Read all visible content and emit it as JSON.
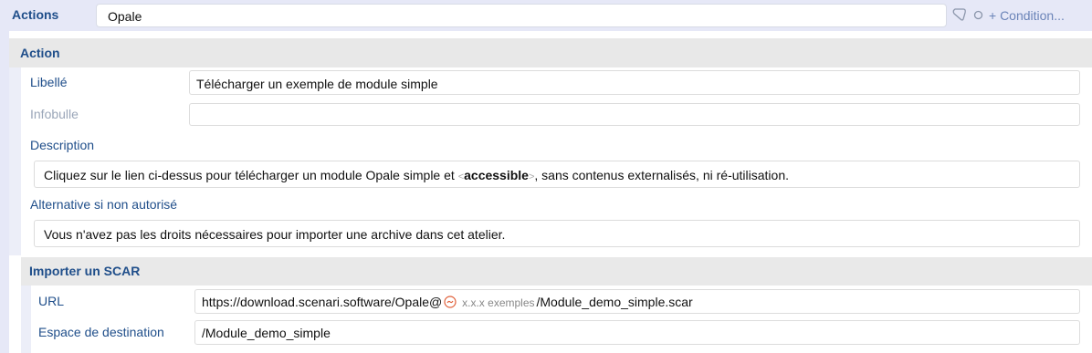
{
  "header": {
    "title": "Actions",
    "value": "Opale",
    "condition_link": "+ Condition...",
    "icons": [
      "condition-shape-icon",
      "circle-icon"
    ]
  },
  "action": {
    "section_title": "Action",
    "libelle_label": "Libellé",
    "libelle_value": "Télécharger un exemple de module simple",
    "infobulle_label": "Infobulle",
    "infobulle_value": "",
    "description_label": "Description",
    "description_before": "Cliquez sur le lien ci-dessus pour télécharger un module Opale simple et ",
    "description_tag_open": "<",
    "description_bold": "accessible",
    "description_tag_close": ">",
    "description_after": ", sans contenus externalisés, ni ré-utilisation.",
    "alternative_label": "Alternative si non autorisé",
    "alternative_value": "Vous n'avez pas les droits nécessaires pour importer une archive dans cet atelier."
  },
  "import": {
    "section_title": "Importer un SCAR",
    "url_label": "URL",
    "url_prefix": "https://download.scenari.software/Opale@",
    "url_variable": "x.x.x exemples",
    "url_suffix": "/Module_demo_simple.scar",
    "destination_label": "Espace de destination",
    "destination_value": "/Module_demo_simple"
  },
  "colors": {
    "header_bg": "#e6e8f7",
    "label_blue": "#1f4e8a",
    "section_bg": "#e8e8e8",
    "link_blue": "#6b84b8",
    "variable_orange": "#e0603a"
  }
}
